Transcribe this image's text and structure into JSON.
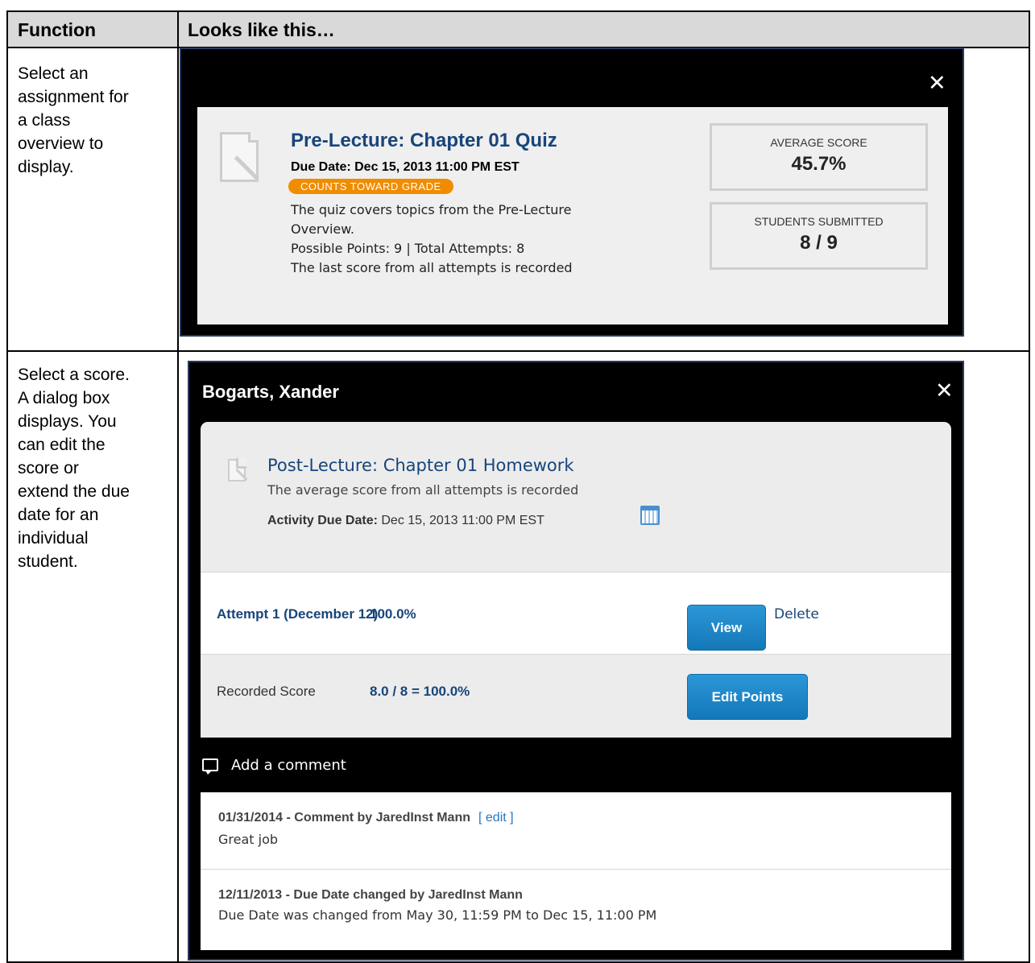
{
  "table": {
    "col_function": "Function",
    "col_looks": "Looks like this…",
    "rows": [
      {
        "description_lines": [
          "Select an",
          "assignment for",
          "a class",
          "overview to",
          "display."
        ]
      },
      {
        "description_lines": [
          "Select a score.",
          "A dialog box",
          "displays. You",
          "can edit the",
          "score or",
          "extend the due",
          "date for an",
          "individual",
          "student."
        ]
      }
    ]
  },
  "overview": {
    "close_symbol": "✕",
    "title": "Pre-Lecture: Chapter 01 Quiz",
    "due_date": "Due Date: Dec 15, 2013 11:00 PM EST",
    "badge": "COUNTS TOWARD GRADE",
    "desc_line1": "The quiz covers topics from the Pre-Lecture",
    "desc_line2": "Overview.",
    "points": "Possible Points: 9 | Total Attempts: 8",
    "scoring": "The last score from all attempts is recorded",
    "average_label": "AVERAGE SCORE",
    "average_value": "45.7%",
    "submitted_label": "STUDENTS SUBMITTED",
    "submitted_value": "8 / 9"
  },
  "student_dialog": {
    "close_symbol": "✕",
    "student_name": "Bogarts, Xander",
    "assignment_title": "Post-Lecture: Chapter 01 Homework",
    "assignment_sub": "The average score from all attempts is recorded",
    "due_label": "Activity Due Date:",
    "due_value": "Dec 15, 2013 11:00 PM EST",
    "attempt_label": "Attempt 1 (December 12)",
    "attempt_score": "100.0%",
    "view_button": "View",
    "delete_link": "Delete",
    "recorded_label": "Recorded Score",
    "recorded_value": "8.0 / 8 = 100.0%",
    "edit_button": "Edit Points",
    "add_comment": "Add a comment",
    "comments": [
      {
        "header": "01/31/2014 - Comment by JaredInst Mann",
        "edit": "[ edit ]",
        "text": "Great job"
      },
      {
        "header": "12/11/2013 - Due Date changed by JaredInst Mann",
        "text": "Due Date was changed from May 30, 11:59 PM to Dec 15, 11:00 PM"
      }
    ]
  }
}
